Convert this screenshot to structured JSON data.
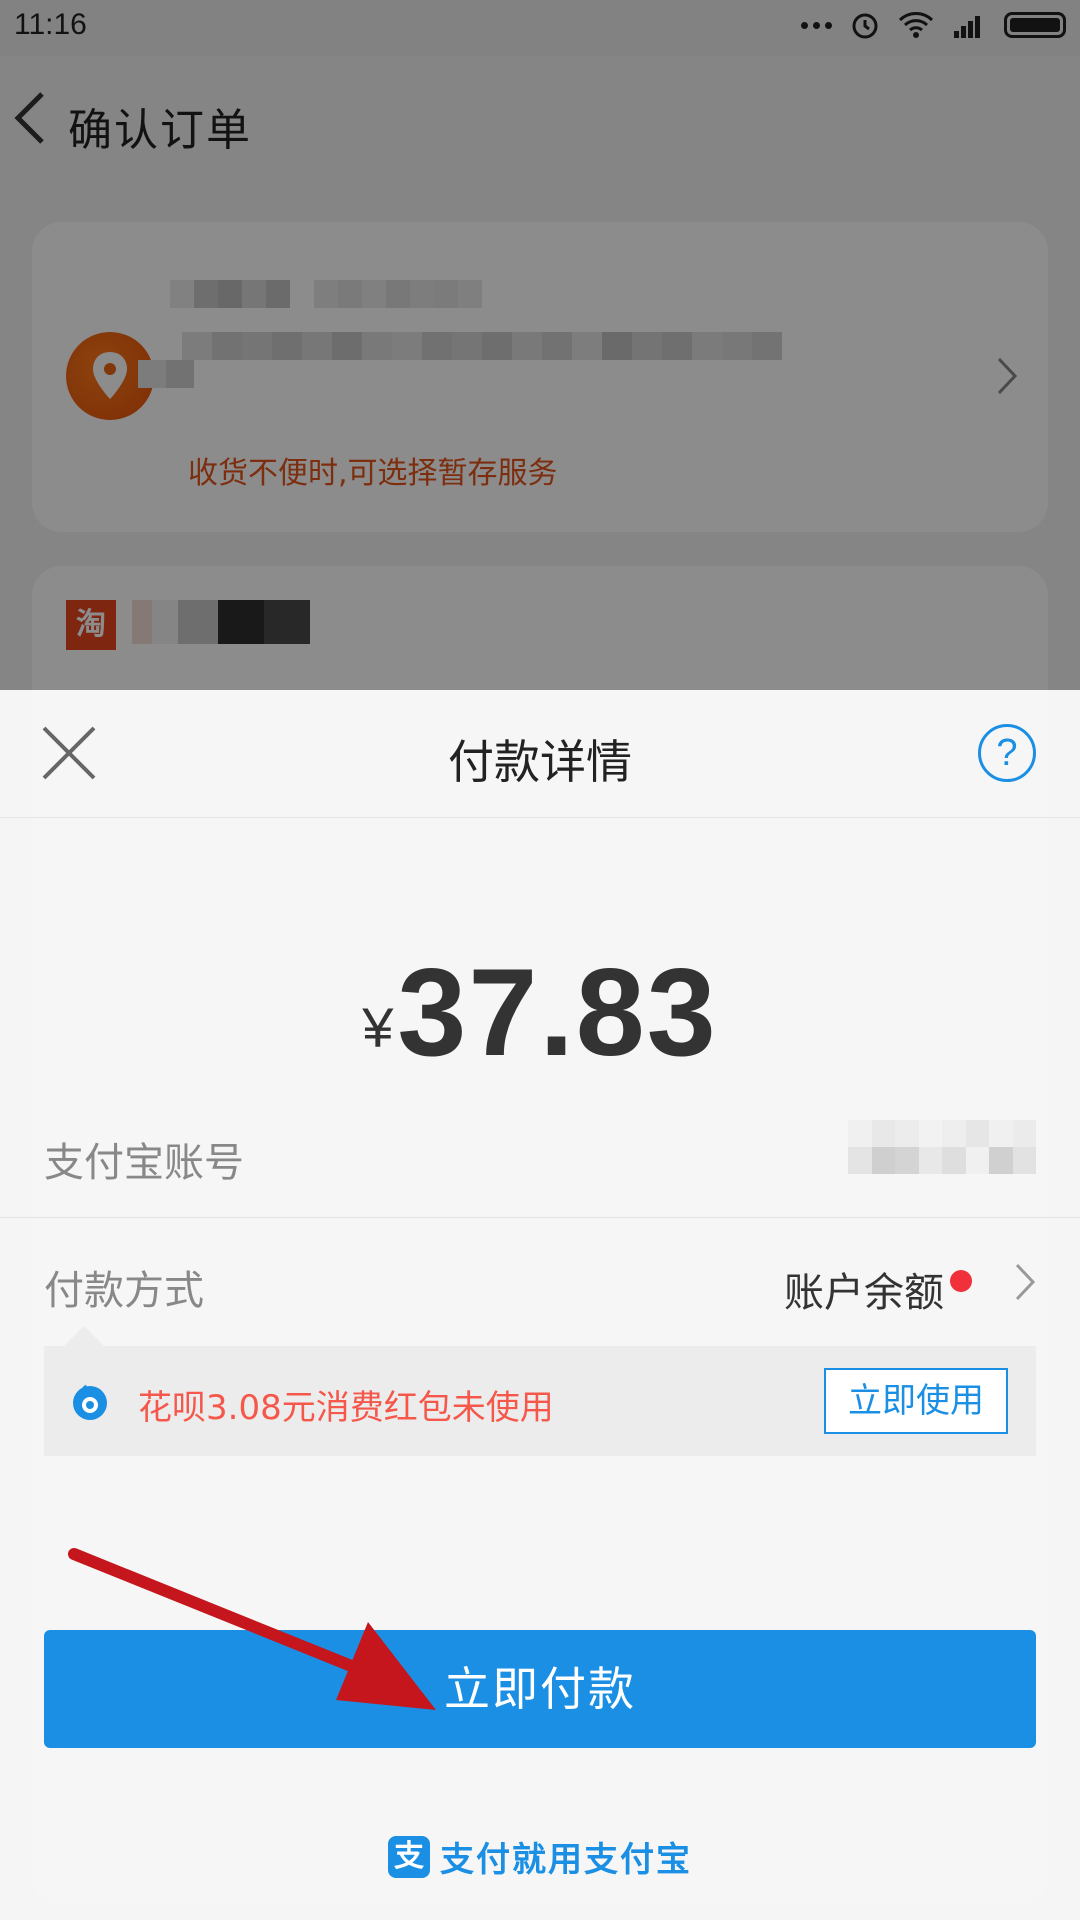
{
  "status_bar": {
    "time": "11:16"
  },
  "nav": {
    "title": "确认订单"
  },
  "address_card": {
    "note": "收货不便时,可选择暂存服务"
  },
  "shop_card": {
    "badge": "淘"
  },
  "payment_sheet": {
    "title": "付款详情",
    "help_label": "?",
    "currency_symbol": "¥",
    "amount": "37.83",
    "account_label": "支付宝账号",
    "method_label": "付款方式",
    "method_value": "账户余额",
    "promo_text": "花呗3.08元消费红包未使用",
    "promo_button": "立即使用",
    "pay_button": "立即付款",
    "brand_slogan": "支付就用支付宝",
    "brand_logo_char": "支"
  },
  "colors": {
    "accent_blue": "#1b8fe4",
    "promo_red": "#f5584b",
    "notice_orange": "#e2541d",
    "annotation_arrow": "#c4161c"
  },
  "icons": [
    "back-icon",
    "location-pin-icon",
    "chevron-right-icon",
    "close-icon",
    "help-icon",
    "huabei-icon",
    "alipay-logo-icon"
  ]
}
